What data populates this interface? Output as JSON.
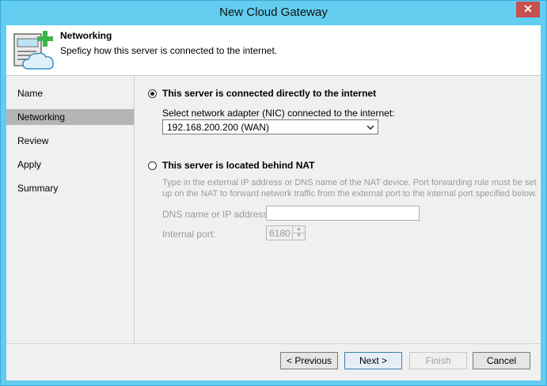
{
  "window": {
    "title": "New Cloud Gateway",
    "close_glyph": "✕"
  },
  "header": {
    "title": "Networking",
    "description": "Speficy how this server is connected to the internet."
  },
  "sidebar": {
    "items": [
      {
        "label": "Name"
      },
      {
        "label": "Networking"
      },
      {
        "label": "Review"
      },
      {
        "label": "Apply"
      },
      {
        "label": "Summary"
      }
    ],
    "active_index": 1
  },
  "main": {
    "direct": {
      "label": "This server is connected directly to the internet",
      "selected": true,
      "nic_prompt": "Select network adapter (NIC) connected to the internet:",
      "nic_value": "192.168.200.200 (WAN)"
    },
    "nat": {
      "label": "This server is located behind NAT",
      "selected": false,
      "help_line1": "Type in the external IP address or DNS name of the NAT device. Port forwarding rule must be set",
      "help_line2": "up on the NAT to forward network traffic from the external port to the internal port specified below.",
      "dns_label": "DNS name or IP address:",
      "dns_value": "",
      "port_label": "Internal port:",
      "port_value": "6180"
    }
  },
  "buttons": {
    "previous": "< Previous",
    "next": "Next >",
    "finish": "Finish",
    "cancel": "Cancel"
  },
  "colors": {
    "title_bar": "#62cdef",
    "close": "#c75050",
    "active_nav": "#b5b5b5",
    "plus_green": "#3bb54a"
  }
}
